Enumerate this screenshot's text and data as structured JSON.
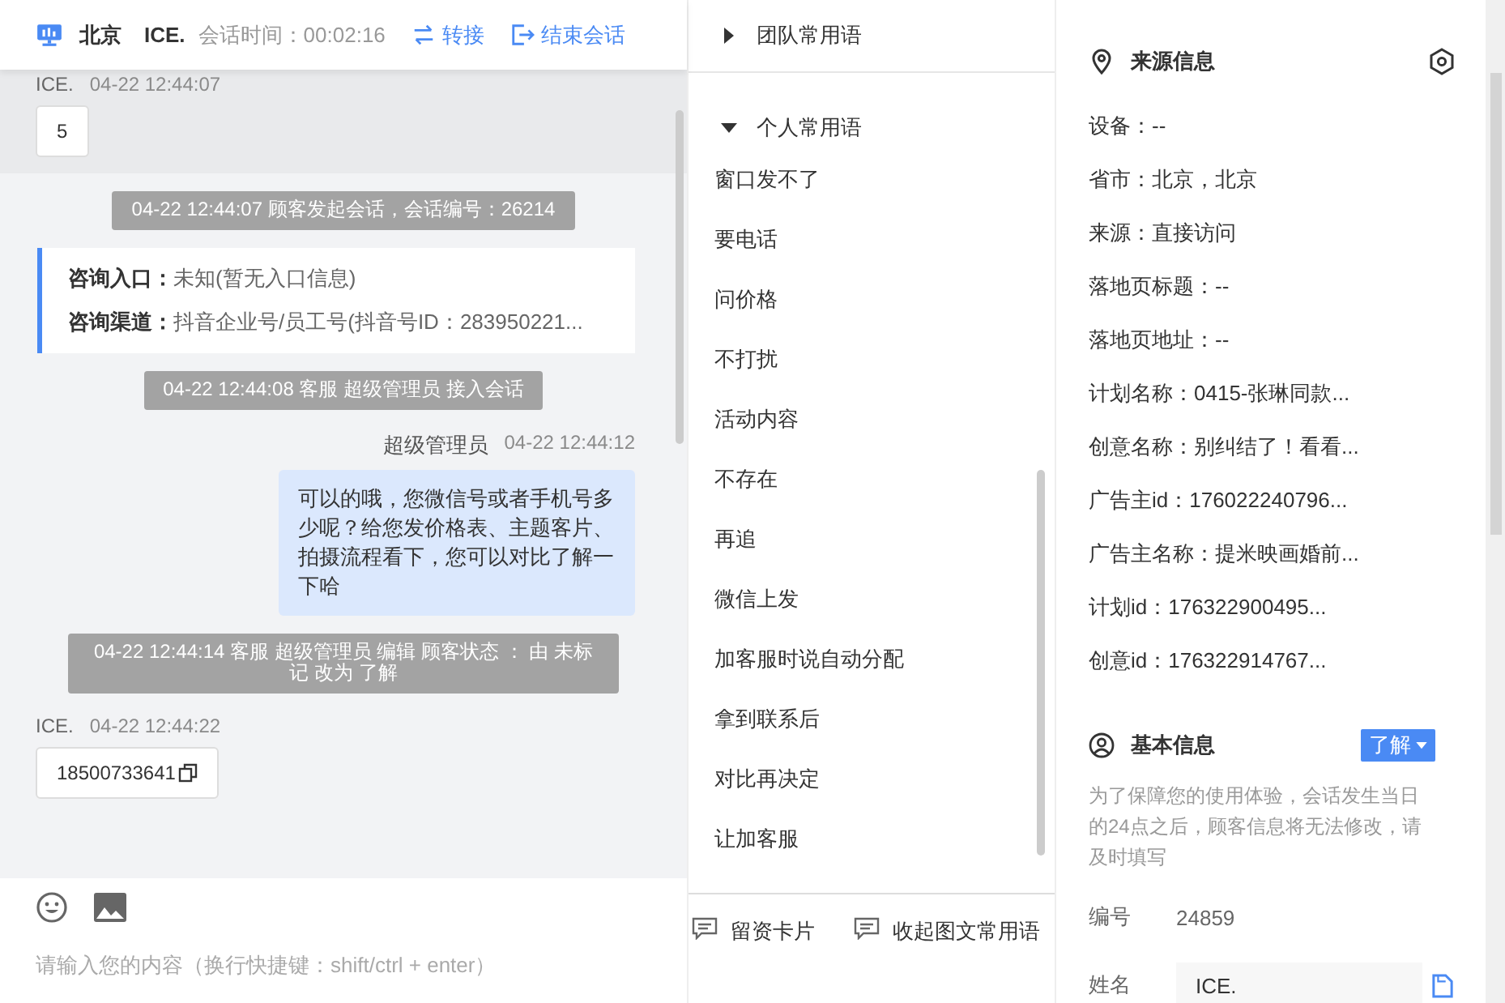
{
  "header": {
    "location": "北京",
    "customer": "ICE.",
    "duration": "会话时间：00:02:16",
    "actions": [
      {
        "kind": "transfer",
        "label": "转接"
      },
      {
        "kind": "end",
        "label": "结束会话"
      }
    ]
  },
  "messages": [
    {
      "kind": "customer",
      "highlighted": true,
      "name": "ICE.",
      "time": "04-22 12:44:07",
      "text": "5",
      "copyable": false
    },
    {
      "kind": "system",
      "text": "04-22 12:44:07 顾客发起会话，会话编号：26214"
    },
    {
      "kind": "entry",
      "rows": [
        {
          "label": "咨询入口：",
          "value": "未知(暂无入口信息)"
        },
        {
          "label": "咨询渠道：",
          "value": "抖音企业号/员工号(抖音号ID：283950221..."
        }
      ]
    },
    {
      "kind": "system",
      "text": "04-22 12:44:08 客服 超级管理员 接入会话"
    },
    {
      "kind": "agent",
      "name": "超级管理员",
      "time": "04-22 12:44:12",
      "text": "可以的哦，您微信号或者手机号多少呢？给您发价格表、主题客片、拍摄流程看下，您可以对比了解一下哈"
    },
    {
      "kind": "system",
      "text": "04-22 12:44:14 客服 超级管理员 编辑 顾客状态 ： 由 未标记 改为 了解"
    },
    {
      "kind": "customer",
      "highlighted": false,
      "name": "ICE.",
      "time": "04-22 12:44:22",
      "text": "18500733641",
      "copyable": true
    }
  ],
  "composer": {
    "placeholder": "请输入您的内容（换行快捷键：shift/ctrl + enter）"
  },
  "phrase_groups": [
    {
      "title": "团队常用语",
      "expanded": false
    },
    {
      "title": "个人常用语",
      "expanded": true,
      "items": [
        "窗口发不了",
        "要电话",
        "问价格",
        "不打扰",
        "活动内容",
        "不存在",
        "再追",
        "微信上发",
        "加客服时说自动分配",
        "拿到联系后",
        "对比再决定",
        "让加客服"
      ]
    }
  ],
  "phrase_actions": [
    "留资卡片",
    "收起图文常用语"
  ],
  "source_info": {
    "title": "来源信息",
    "fields": [
      "设备：--",
      "省市：北京，北京",
      "来源：直接访问",
      "落地页标题：--",
      "落地页地址：--",
      "计划名称：0415-张琳同款...",
      "创意名称：别纠结了！看看...",
      "广告主id：176022240796...",
      "广告主名称：提米映画婚前...",
      "计划id：176322900495...",
      "创意id：176322914767..."
    ]
  },
  "basic_info": {
    "title": "基本信息",
    "status": "了解",
    "note": "为了保障您的使用体验，会话发生当日的24点之后，顾客信息将无法修改，请及时填写",
    "fields": [
      {
        "kind": "text",
        "label": "编号",
        "value": "24859"
      },
      {
        "kind": "input",
        "label": "姓名",
        "value": "ICE."
      }
    ]
  }
}
